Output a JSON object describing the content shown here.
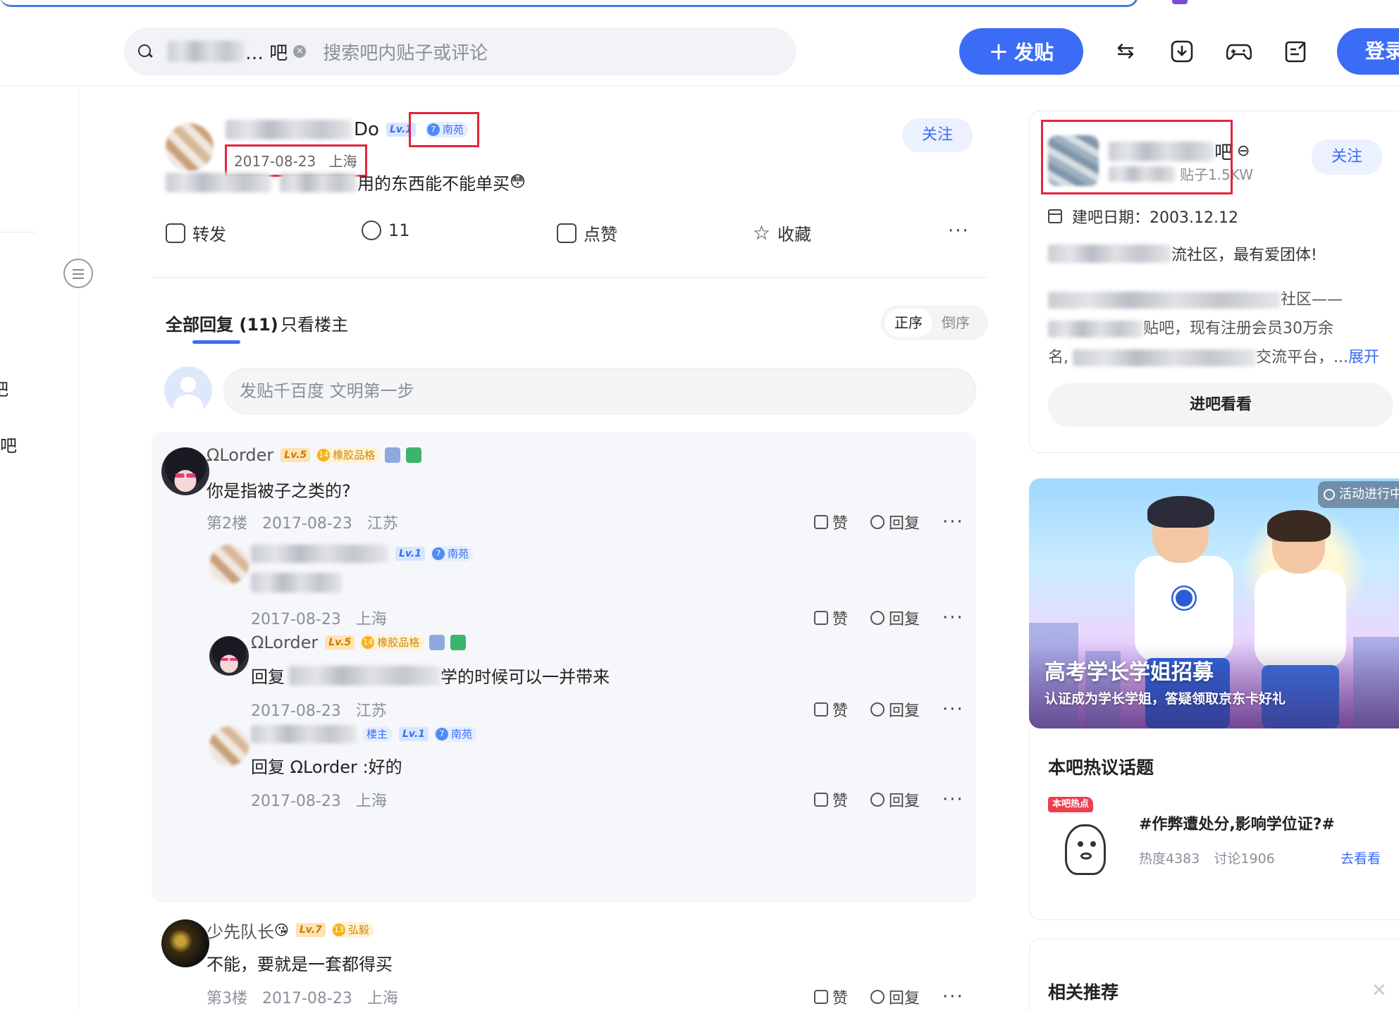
{
  "header": {
    "search_forum_suffix": "… 吧",
    "search_placeholder": "搜索吧内贴子或评论",
    "post_button_label": "发贴",
    "post_button_icon": "plus-icon",
    "toolbar_icons": [
      "switch-icon",
      "download-icon",
      "gamepad-icon",
      "edit-note-icon"
    ],
    "login_label": "登录"
  },
  "left_rail": {
    "items": [
      "吧",
      "吧"
    ]
  },
  "post": {
    "author_name_tail": "Do",
    "author_level": "Lv.1",
    "author_tag_num": "7",
    "author_tag": "南苑",
    "date": "2017-08-23",
    "location": "上海",
    "follow_label": "关注",
    "text_tail": "用的东西能不能单买",
    "actions": {
      "share": "转发",
      "comment_count": "11",
      "like": "点赞",
      "favorite": "收藏"
    }
  },
  "tabs": {
    "all_replies": "全部回复 (11)",
    "only_op": "只看楼主",
    "sort_asc": "正序",
    "sort_desc": "倒序"
  },
  "reply_input_placeholder": "发贴千百度 文明第一步",
  "comments": [
    {
      "name": "ΩLorder",
      "level": "Lv.5",
      "tag_num": "14",
      "tag": "橡胶品格",
      "text": "你是指被子之类的?",
      "floor": "第2楼",
      "date": "2017-08-23",
      "location": "江苏"
    },
    {
      "level": "Lv.1",
      "tag_num": "7",
      "tag": "南苑",
      "date": "2017-08-23",
      "location": "上海"
    },
    {
      "name": "ΩLorder",
      "level": "Lv.5",
      "tag_num": "14",
      "tag": "橡胶品格",
      "text_prefix": "回复",
      "text_tail": "学的时候可以一并带来",
      "date": "2017-08-23",
      "location": "江苏"
    },
    {
      "op_badge": "楼主",
      "level": "Lv.1",
      "tag_num": "7",
      "tag": "南苑",
      "text": "回复 ΩLorder :好的",
      "date": "2017-08-23",
      "location": "上海"
    },
    {
      "name": "少先队长",
      "level": "Lv.7",
      "tag_num": "13",
      "tag": "弘毅",
      "text": "不能，要就是一套都得买",
      "floor": "第3楼",
      "date": "2017-08-23",
      "location": "上海"
    }
  ],
  "comment_actions": {
    "like": "赞",
    "reply": "回复"
  },
  "sidebar": {
    "forum_name_tail": "吧",
    "forum_posts": "贴子1.5KW",
    "follow_label": "关注",
    "founded": "建吧日期：2003.12.12",
    "desc_line1_tail": "流社区，最有爱团体!",
    "desc_line2_tail": "社区——",
    "desc_line3_tail": "贴吧，现有注册会员30万余",
    "desc_line4_prefix": "名,",
    "desc_line4_tail": "交流平台，...",
    "expand_label": "展开",
    "enter_label": "进吧看看",
    "banner": {
      "badge": "活动进行中",
      "title": "高考学长学姐招募",
      "subtitle": "认证成为学长学姐，答疑领取京东卡好礼"
    },
    "hot": {
      "title": "本吧热议话题",
      "flag": "本吧热点",
      "topic": "#作弊遭处分,影响学位证?#",
      "heat": "热度4383",
      "discuss": "讨论1906",
      "go_label": "去看看"
    },
    "rec_title": "相关推荐"
  },
  "colors": {
    "accent": "#3b6cf5",
    "highlight_box": "#e5243b"
  }
}
